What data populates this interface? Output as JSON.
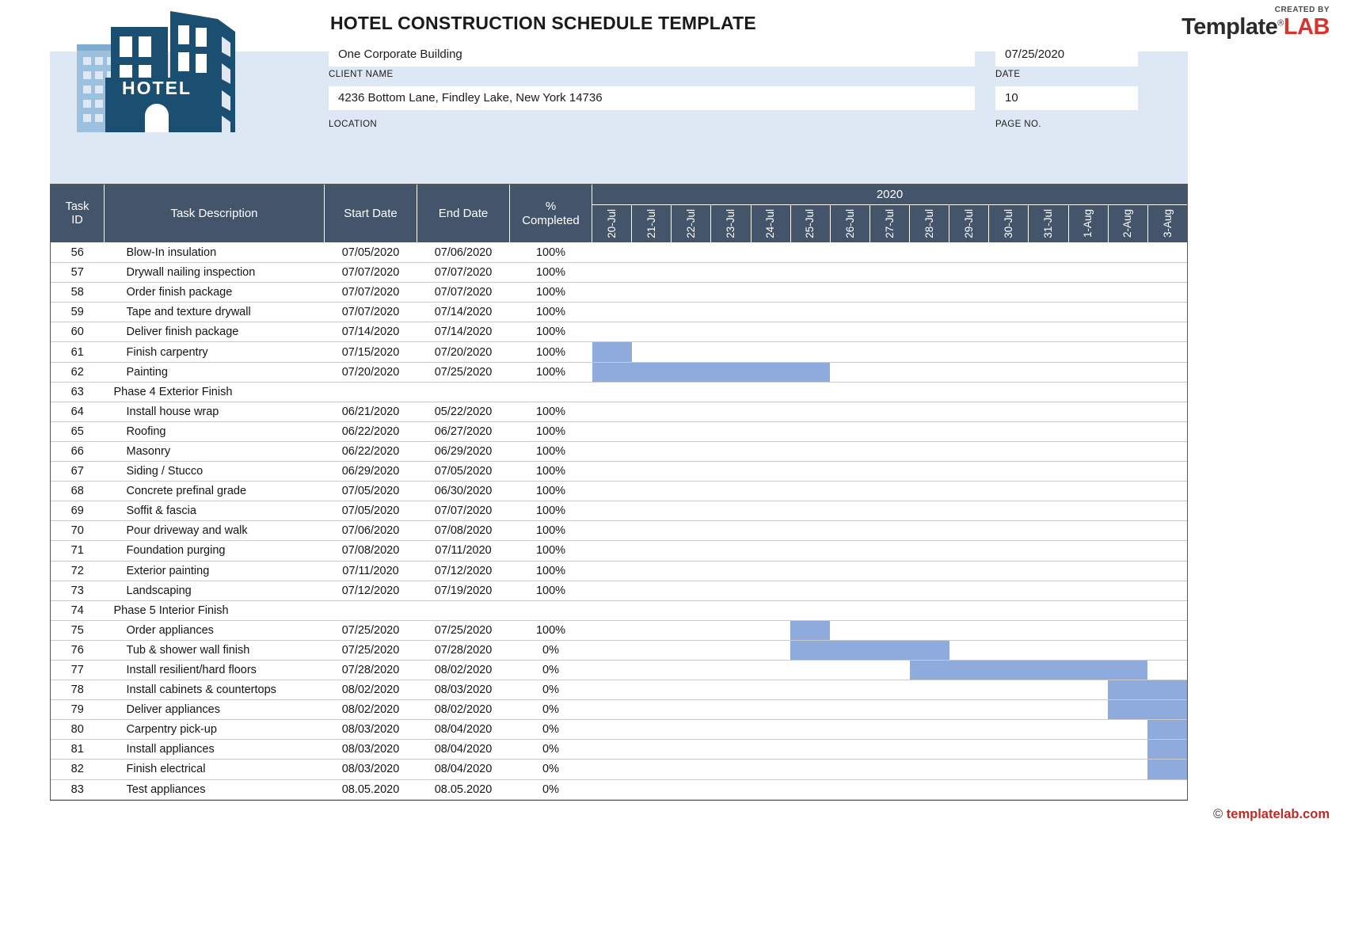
{
  "brand": {
    "created_by": "CREATED BY",
    "name_part1": "Template",
    "name_part2": "LAB",
    "trademark": "®"
  },
  "header": {
    "title": "HOTEL CONSTRUCTION SCHEDULE TEMPLATE",
    "client_name_value": "One Corporate Building",
    "client_name_label": "CLIENT NAME",
    "location_value": "4236 Bottom Lane, Findley Lake, New York  14736",
    "location_label": "LOCATION",
    "date_value": "07/25/2020",
    "date_label": "DATE",
    "page_no_value": "10",
    "page_no_label": "PAGE NO."
  },
  "table": {
    "headers": {
      "task_id": "Task ID",
      "task_id_line1": "Task",
      "task_id_line2": "ID",
      "task_description": "Task Description",
      "start_date": "Start Date",
      "end_date": "End Date",
      "percent_completed_line1": "%",
      "percent_completed_line2": "Completed",
      "year": "2020"
    },
    "timeline_days": [
      "20-Jul",
      "21-Jul",
      "22-Jul",
      "23-Jul",
      "24-Jul",
      "25-Jul",
      "26-Jul",
      "27-Jul",
      "28-Jul",
      "29-Jul",
      "30-Jul",
      "31-Jul",
      "1-Aug",
      "2-Aug",
      "3-Aug"
    ],
    "rows": [
      {
        "id": "56",
        "desc": "Blow-In  insulation",
        "start": "07/05/2020",
        "end": "07/06/2020",
        "pct": "100%",
        "group": false,
        "bar": null
      },
      {
        "id": "57",
        "desc": "Drywall nailing inspection",
        "start": "07/07/2020",
        "end": "07/07/2020",
        "pct": "100%",
        "group": false,
        "bar": null
      },
      {
        "id": "58",
        "desc": "Order finish package",
        "start": "07/07/2020",
        "end": "07/07/2020",
        "pct": "100%",
        "group": false,
        "bar": null
      },
      {
        "id": "59",
        "desc": "Tape and texture drywall",
        "start": "07/07/2020",
        "end": "07/14/2020",
        "pct": "100%",
        "group": false,
        "bar": null
      },
      {
        "id": "60",
        "desc": "Deliver finish package",
        "start": "07/14/2020",
        "end": "07/14/2020",
        "pct": "100%",
        "group": false,
        "bar": null
      },
      {
        "id": "61",
        "desc": "Finish carpentry",
        "start": "07/15/2020",
        "end": "07/20/2020",
        "pct": "100%",
        "group": false,
        "bar": {
          "start_index": 0,
          "span": 1
        }
      },
      {
        "id": "62",
        "desc": "Painting",
        "start": "07/20/2020",
        "end": "07/25/2020",
        "pct": "100%",
        "group": false,
        "bar": {
          "start_index": 0,
          "span": 6
        }
      },
      {
        "id": "63",
        "desc": "Phase 4 Exterior Finish",
        "start": "",
        "end": "",
        "pct": "",
        "group": true,
        "bar": null
      },
      {
        "id": "64",
        "desc": "Install house wrap",
        "start": "06/21/2020",
        "end": "05/22/2020",
        "pct": "100%",
        "group": false,
        "bar": null
      },
      {
        "id": "65",
        "desc": "Roofing",
        "start": "06/22/2020",
        "end": "06/27/2020",
        "pct": "100%",
        "group": false,
        "bar": null
      },
      {
        "id": "66",
        "desc": "Masonry",
        "start": "06/22/2020",
        "end": "06/29/2020",
        "pct": "100%",
        "group": false,
        "bar": null
      },
      {
        "id": "67",
        "desc": "Siding / Stucco",
        "start": "06/29/2020",
        "end": "07/05/2020",
        "pct": "100%",
        "group": false,
        "bar": null
      },
      {
        "id": "68",
        "desc": "Concrete prefinal grade",
        "start": "07/05/2020",
        "end": "06/30/2020",
        "pct": "100%",
        "group": false,
        "bar": null
      },
      {
        "id": "69",
        "desc": "Soffit & fascia",
        "start": "07/05/2020",
        "end": "07/07/2020",
        "pct": "100%",
        "group": false,
        "bar": null
      },
      {
        "id": "70",
        "desc": "Pour driveway and walk",
        "start": "07/06/2020",
        "end": "07/08/2020",
        "pct": "100%",
        "group": false,
        "bar": null
      },
      {
        "id": "71",
        "desc": "Foundation purging",
        "start": "07/08/2020",
        "end": "07/11/2020",
        "pct": "100%",
        "group": false,
        "bar": null
      },
      {
        "id": "72",
        "desc": "Exterior painting",
        "start": "07/11/2020",
        "end": "07/12/2020",
        "pct": "100%",
        "group": false,
        "bar": null
      },
      {
        "id": "73",
        "desc": "Landscaping",
        "start": "07/12/2020",
        "end": "07/19/2020",
        "pct": "100%",
        "group": false,
        "bar": null
      },
      {
        "id": "74",
        "desc": "Phase 5 Interior Finish",
        "start": "",
        "end": "",
        "pct": "",
        "group": true,
        "bar": null
      },
      {
        "id": "75",
        "desc": "Order appliances",
        "start": "07/25/2020",
        "end": "07/25/2020",
        "pct": "100%",
        "group": false,
        "bar": {
          "start_index": 5,
          "span": 1
        }
      },
      {
        "id": "76",
        "desc": "Tub & shower wall finish",
        "start": "07/25/2020",
        "end": "07/28/2020",
        "pct": "0%",
        "group": false,
        "bar": {
          "start_index": 5,
          "span": 4
        }
      },
      {
        "id": "77",
        "desc": "Install resilient/hard floors",
        "start": "07/28/2020",
        "end": "08/02/2020",
        "pct": "0%",
        "group": false,
        "bar": {
          "start_index": 8,
          "span": 6
        }
      },
      {
        "id": "78",
        "desc": "Install cabinets & countertops",
        "start": "08/02/2020",
        "end": "08/03/2020",
        "pct": "0%",
        "group": false,
        "bar": {
          "start_index": 13,
          "span": 2
        }
      },
      {
        "id": "79",
        "desc": "Deliver appliances",
        "start": "08/02/2020",
        "end": "08/02/2020",
        "pct": "0%",
        "group": false,
        "bar": {
          "start_index": 13,
          "span": 2
        }
      },
      {
        "id": "80",
        "desc": "Carpentry pick-up",
        "start": "08/03/2020",
        "end": "08/04/2020",
        "pct": "0%",
        "group": false,
        "bar": {
          "start_index": 14,
          "span": 1
        }
      },
      {
        "id": "81",
        "desc": "Install appliances",
        "start": "08/03/2020",
        "end": "08/04/2020",
        "pct": "0%",
        "group": false,
        "bar": {
          "start_index": 14,
          "span": 1
        }
      },
      {
        "id": "82",
        "desc": "Finish electrical",
        "start": "08/03/2020",
        "end": "08/04/2020",
        "pct": "0%",
        "group": false,
        "bar": {
          "start_index": 14,
          "span": 1
        }
      },
      {
        "id": "83",
        "desc": "Test appliances",
        "start": "08.05.2020",
        "end": "08.05.2020",
        "pct": "0%",
        "group": false,
        "bar": null
      }
    ]
  },
  "footer": {
    "copyright": "©",
    "site": "templatelab.com"
  },
  "colors": {
    "header_band": "#dde8f4",
    "table_header": "#44546a",
    "gantt_bar": "#8faadc",
    "brand_red": "#d9342b",
    "logo_dark": "#1b4f72",
    "logo_light": "#9cc0de"
  },
  "chart_data": {
    "type": "bar",
    "title": "Hotel Construction Schedule Gantt",
    "xlabel": "2020",
    "ylabel": "Task",
    "categories": [
      "20-Jul",
      "21-Jul",
      "22-Jul",
      "23-Jul",
      "24-Jul",
      "25-Jul",
      "26-Jul",
      "27-Jul",
      "28-Jul",
      "29-Jul",
      "30-Jul",
      "31-Jul",
      "1-Aug",
      "2-Aug",
      "3-Aug"
    ],
    "series": [
      {
        "name": "61 Finish carpentry",
        "start_index": 0,
        "span": 1
      },
      {
        "name": "62 Painting",
        "start_index": 0,
        "span": 6
      },
      {
        "name": "75 Order appliances",
        "start_index": 5,
        "span": 1
      },
      {
        "name": "76 Tub & shower wall finish",
        "start_index": 5,
        "span": 4
      },
      {
        "name": "77 Install resilient/hard floors",
        "start_index": 8,
        "span": 6
      },
      {
        "name": "78 Install cabinets & countertops",
        "start_index": 13,
        "span": 2
      },
      {
        "name": "79 Deliver appliances",
        "start_index": 13,
        "span": 2
      },
      {
        "name": "80 Carpentry pick-up",
        "start_index": 14,
        "span": 1
      },
      {
        "name": "81 Install appliances",
        "start_index": 14,
        "span": 1
      },
      {
        "name": "82 Finish electrical",
        "start_index": 14,
        "span": 1
      }
    ]
  }
}
